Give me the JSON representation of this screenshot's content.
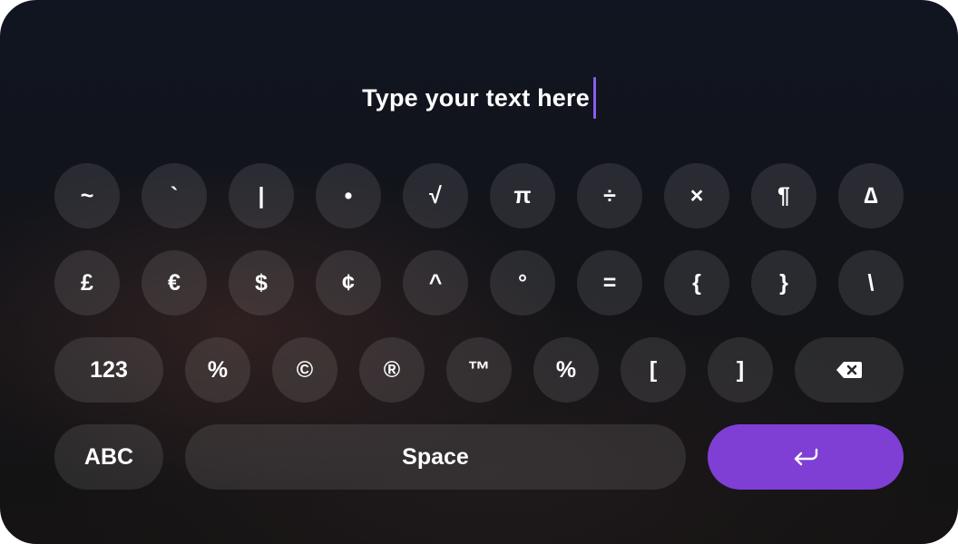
{
  "text_field": {
    "value": "Type your text here"
  },
  "rows": [
    [
      "~",
      "`",
      "|",
      "•",
      "√",
      "π",
      "÷",
      "×",
      "¶",
      "∆"
    ],
    [
      "£",
      "€",
      "$",
      "¢",
      "^",
      "°",
      "=",
      "{",
      "}",
      "\\"
    ],
    [
      "123",
      "%",
      "©",
      "®",
      "™",
      "%",
      "[",
      "]"
    ]
  ],
  "bottom_row": {
    "abc_label": "ABC",
    "space_label": "Space"
  },
  "icons": {
    "backspace": "backspace-icon",
    "enter": "return-arrow-icon"
  },
  "colors": {
    "accent": "#7f3fd4",
    "caret": "#8a5cf0",
    "key_bg": "#2b2b2e"
  }
}
